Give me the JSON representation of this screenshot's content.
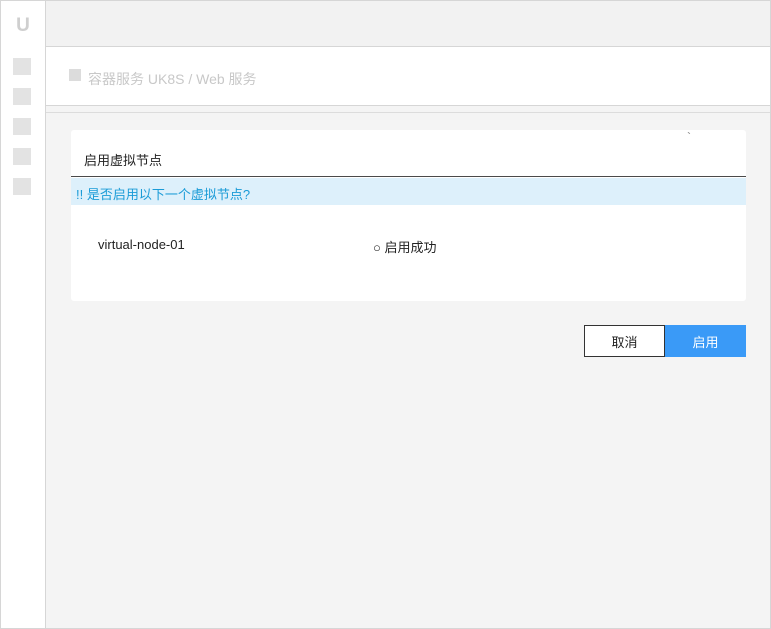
{
  "sidebar": {
    "logo": "U",
    "items": [
      {
        "icon": "nav-icon-1"
      },
      {
        "icon": "nav-icon-2"
      },
      {
        "icon": "nav-icon-3"
      },
      {
        "icon": "nav-icon-4"
      },
      {
        "icon": "nav-icon-5"
      }
    ]
  },
  "breadcrumb": {
    "text": "容器服务 UK8S / Web 服务"
  },
  "dialog": {
    "title": "启用虚拟节点",
    "corner_mark": "`",
    "prompt": "!! 是否启用以下一个虚拟节点?",
    "rows": [
      {
        "name": "virtual-node-01",
        "status": "○ 启用成功"
      }
    ]
  },
  "buttons": {
    "cancel": "取消",
    "confirm": "启用"
  },
  "colors": {
    "accent": "#3a9af7",
    "banner_bg": "#ddf0fb",
    "banner_text": "#1a9bd7"
  }
}
